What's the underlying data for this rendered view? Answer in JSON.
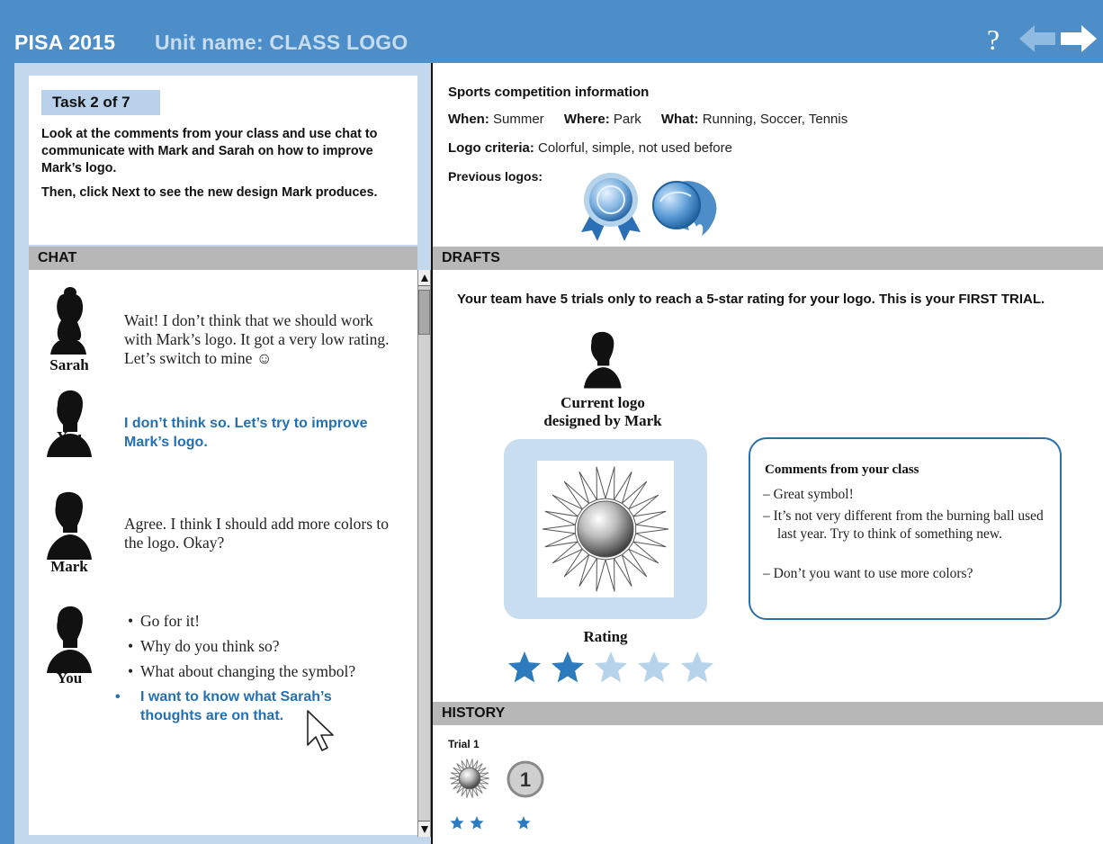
{
  "header": {
    "app_title": "PISA 2015",
    "unit_title": "Unit name: CLASS LOGO",
    "help_label": "?",
    "icons": [
      "help-icon",
      "arrow-left-icon",
      "arrow-right-icon"
    ]
  },
  "task": {
    "badge": "Task 2 of 7",
    "instruction": "Look at the comments from your class and use chat to communicate with Mark and Sarah on how to improve Mark’s logo.",
    "instruction_next": "Then, click Next to see the new design Mark produces."
  },
  "sections": {
    "chat": "CHAT",
    "drafts": "DRAFTS",
    "history": "HISTORY"
  },
  "chat": {
    "messages": [
      {
        "speaker": "Sarah",
        "text": "Wait! I don’t think that we should work with Mark’s logo. It got a very low rating. Let’s switch to mine ☺"
      },
      {
        "speaker": "You",
        "text": "I don’t think so. Let’s try to improve Mark’s logo."
      },
      {
        "speaker": "Mark",
        "text": "Agree. I think I should add more colors to the logo. Okay?"
      }
    ],
    "reply": {
      "speaker": "You",
      "options": [
        {
          "text": "Go for it!",
          "selected": false
        },
        {
          "text": "Why do you think so?",
          "selected": false
        },
        {
          "text": "What about changing the symbol?",
          "selected": false
        },
        {
          "text": "I want to know what Sarah’s thoughts are on that.",
          "selected": true
        }
      ],
      "bullet": "•"
    }
  },
  "info": {
    "title": "Sports competition information",
    "when_label": "When:",
    "when_value": "Summer",
    "where_label": "Where:",
    "where_value": "Park",
    "what_label": "What:",
    "what_value": "Running, Soccer, Tennis",
    "criteria_label": "Logo criteria:",
    "criteria_value": "Colorful, simple, not used before",
    "previous_label": "Previous logos:",
    "previous_logos": [
      "medal-ribbon-logo",
      "burning-ball-logo"
    ]
  },
  "drafts": {
    "intro": "Your team have 5 trials only to reach a 5-star rating for your logo. This is your FIRST TRIAL.",
    "caption_line1": "Current logo",
    "caption_line2": "designed by Mark",
    "logo": "sun-sphere-logo",
    "rating_label": "Rating",
    "rating": 2,
    "rating_max": 5
  },
  "comments": {
    "title": "Comments from your class",
    "items": [
      "– Great symbol!",
      "– It’s not very different from the burning ball used last year. Try to think of something new.",
      "– Don’t you want to use more colors?"
    ]
  },
  "history": {
    "trials": [
      {
        "label": "Trial 1",
        "logo": "sun-sphere-logo",
        "logo_rating": 2,
        "badge": "1",
        "badge_rating": 1
      }
    ]
  },
  "colors": {
    "header_bar": "#4d8ec9",
    "panel_bg": "#c3d8ec",
    "section_header": "#b7b7b7",
    "selected_text": "#2470b0",
    "star_filled": "#2c7bbf",
    "star_empty": "#b6d3ec"
  }
}
